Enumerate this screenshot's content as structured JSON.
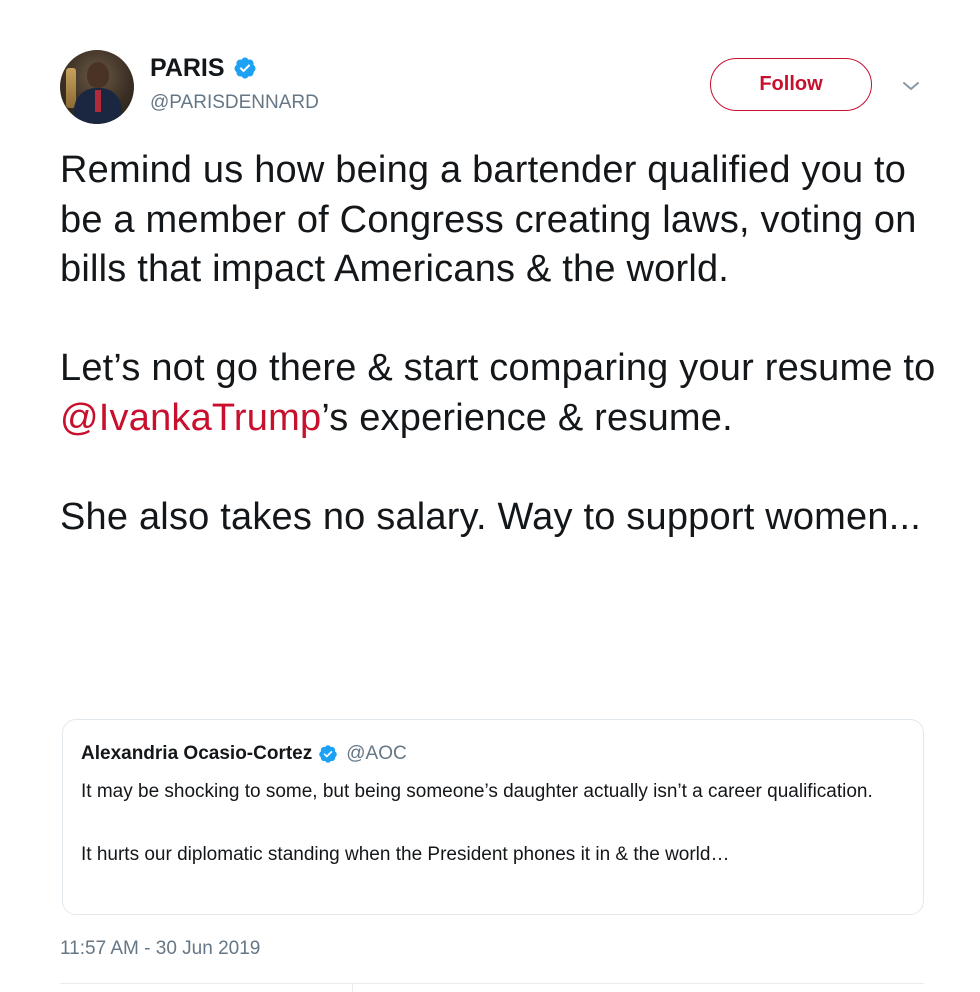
{
  "author": {
    "display_name": "PARIS",
    "handle": "@PARISDENNARD",
    "avatar_icon": "profile-photo",
    "verified_icon": "verified-badge-icon"
  },
  "actions": {
    "follow_label": "Follow",
    "menu_icon": "chevron-down-icon"
  },
  "tweet": {
    "paragraphs": {
      "p1": "Remind us how being a bartender qualified you to be a member of Congress creating laws, voting on bills that impact Americans & the world.",
      "p2_before": "Let’s not go there & start comparing your resume to ",
      "p2_mention": "@IvankaTrump",
      "p2_after": "’s experience & resume.",
      "p3": "She also takes no salary. Way to support women..."
    },
    "timestamp": "11:57 AM - 30 Jun 2019"
  },
  "quoted_tweet": {
    "display_name": "Alexandria Ocasio-Cortez",
    "handle": "@AOC",
    "paragraph1": "It may be shocking to some, but being someone’s daughter actually isn’t a career qualification.",
    "paragraph2": "It hurts our diplomatic standing when the President phones it in & the world…"
  },
  "colors": {
    "accent": "#c8102e",
    "verified": "#1da1f2",
    "muted": "#657786",
    "text": "#14171a",
    "border": "#e1e8ed"
  }
}
